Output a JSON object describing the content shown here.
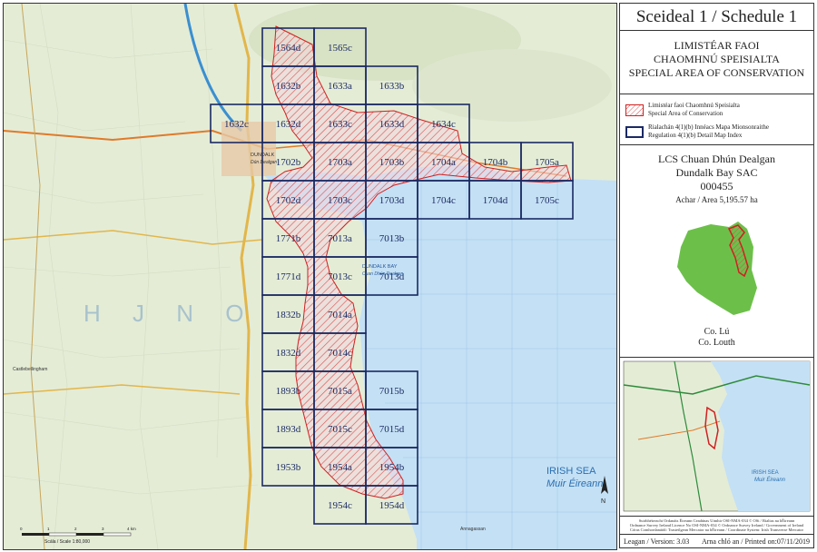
{
  "schedule_title": "Sceideal 1 / Schedule 1",
  "sac_type": {
    "line1": "LIMISTÉAR FAOI",
    "line2": "CHAOMHNÚ SPEISIALTA",
    "line3": "SPECIAL AREA OF CONSERVATION"
  },
  "legend": {
    "sac_ga": "Limistéar faoi Chaomhnú Speisialta",
    "sac_en": "Special Area of Conservation",
    "index_ga": "Rialachán 4(1)(b) Innéacs Mapa Mionsonraithe",
    "index_en": "Regulation 4(1)(b) Detail Map Index"
  },
  "site": {
    "name_ga": "LCS Chuan Dhún Dealgan",
    "name_en": "Dundalk Bay SAC",
    "code": "000455",
    "area": "Achar / Area 5,195.57 ha",
    "county_ga": "Co. Lú",
    "county_en": "Co. Louth"
  },
  "credits": {
    "line1": "Suirbhéireacht Ordanáis Éireann Ceadúnas Uimhir OSI-NMA-034 © OSi / Rialtas na hÉireann",
    "line2": "Ordnance Survey Ireland Licence No OSI-NMA-034 © Ordnance Survey Ireland / Government of Ireland",
    "line3": "Córas Comhordanáidí: Trasteilgean Mercator na hÉireann / Coordinate System: Irish Transverse Mercator"
  },
  "footer": {
    "version": "Leagan / Version: 3.03",
    "printed": "Arna chló an / Printed on:07/11/2019"
  },
  "map": {
    "place_labels": {
      "town": "DUNDALK",
      "town_ga": "Dún Dealgan",
      "bay": "DUNDALK BAY",
      "bay_ga": "Cuan Dhún Dealgan",
      "sea": "IRISH SEA",
      "sea_ga": "Muir Éireann",
      "grid_square": "H J N O",
      "annesley": "Annagassan",
      "townland": "Castlebellingham"
    },
    "scale": {
      "label": "Scála / Scale 1:80,000",
      "ticks": [
        "0",
        "1",
        "2",
        "3",
        "4 km"
      ]
    },
    "tiles": [
      {
        "id": "1564d",
        "col": 1,
        "row": 0
      },
      {
        "id": "1565c",
        "col": 2,
        "row": 0
      },
      {
        "id": "1632b",
        "col": 1,
        "row": 1
      },
      {
        "id": "1633a",
        "col": 2,
        "row": 1
      },
      {
        "id": "1633b",
        "col": 3,
        "row": 1
      },
      {
        "id": "1632c",
        "col": 0,
        "row": 2
      },
      {
        "id": "1632d",
        "col": 1,
        "row": 2
      },
      {
        "id": "1633c",
        "col": 2,
        "row": 2
      },
      {
        "id": "1633d",
        "col": 3,
        "row": 2
      },
      {
        "id": "1634c",
        "col": 4,
        "row": 2
      },
      {
        "id": "1702b",
        "col": 1,
        "row": 3
      },
      {
        "id": "1703a",
        "col": 2,
        "row": 3
      },
      {
        "id": "1703b",
        "col": 3,
        "row": 3
      },
      {
        "id": "1704a",
        "col": 4,
        "row": 3
      },
      {
        "id": "1704b",
        "col": 5,
        "row": 3
      },
      {
        "id": "1705a",
        "col": 6,
        "row": 3
      },
      {
        "id": "1702d",
        "col": 1,
        "row": 4
      },
      {
        "id": "1703c",
        "col": 2,
        "row": 4
      },
      {
        "id": "1703d",
        "col": 3,
        "row": 4
      },
      {
        "id": "1704c",
        "col": 4,
        "row": 4
      },
      {
        "id": "1704d",
        "col": 5,
        "row": 4
      },
      {
        "id": "1705c",
        "col": 6,
        "row": 4
      },
      {
        "id": "1771b",
        "col": 1,
        "row": 5
      },
      {
        "id": "7013a",
        "col": 2,
        "row": 5
      },
      {
        "id": "7013b",
        "col": 3,
        "row": 5
      },
      {
        "id": "1771d",
        "col": 1,
        "row": 6
      },
      {
        "id": "7013c",
        "col": 2,
        "row": 6
      },
      {
        "id": "7013d",
        "col": 3,
        "row": 6
      },
      {
        "id": "1832b",
        "col": 1,
        "row": 7
      },
      {
        "id": "7014a",
        "col": 2,
        "row": 7
      },
      {
        "id": "1832d",
        "col": 1,
        "row": 8
      },
      {
        "id": "7014c",
        "col": 2,
        "row": 8
      },
      {
        "id": "1893b",
        "col": 1,
        "row": 9
      },
      {
        "id": "7015a",
        "col": 2,
        "row": 9
      },
      {
        "id": "7015b",
        "col": 3,
        "row": 9
      },
      {
        "id": "1893d",
        "col": 1,
        "row": 10
      },
      {
        "id": "7015c",
        "col": 2,
        "row": 10
      },
      {
        "id": "7015d",
        "col": 3,
        "row": 10
      },
      {
        "id": "1953b",
        "col": 1,
        "row": 11
      },
      {
        "id": "1954a",
        "col": 2,
        "row": 11
      },
      {
        "id": "1954b",
        "col": 3,
        "row": 11
      },
      {
        "id": "1954c",
        "col": 2,
        "row": 12
      },
      {
        "id": "1954d",
        "col": 3,
        "row": 12
      }
    ],
    "colors": {
      "land": "#e4ecd6",
      "sea": "#c4e0f5",
      "tile_border": "#1b2a63",
      "sac_outline": "#d02020",
      "sac_hatch": "#d85050",
      "county_fill": "#6cc04a"
    }
  }
}
